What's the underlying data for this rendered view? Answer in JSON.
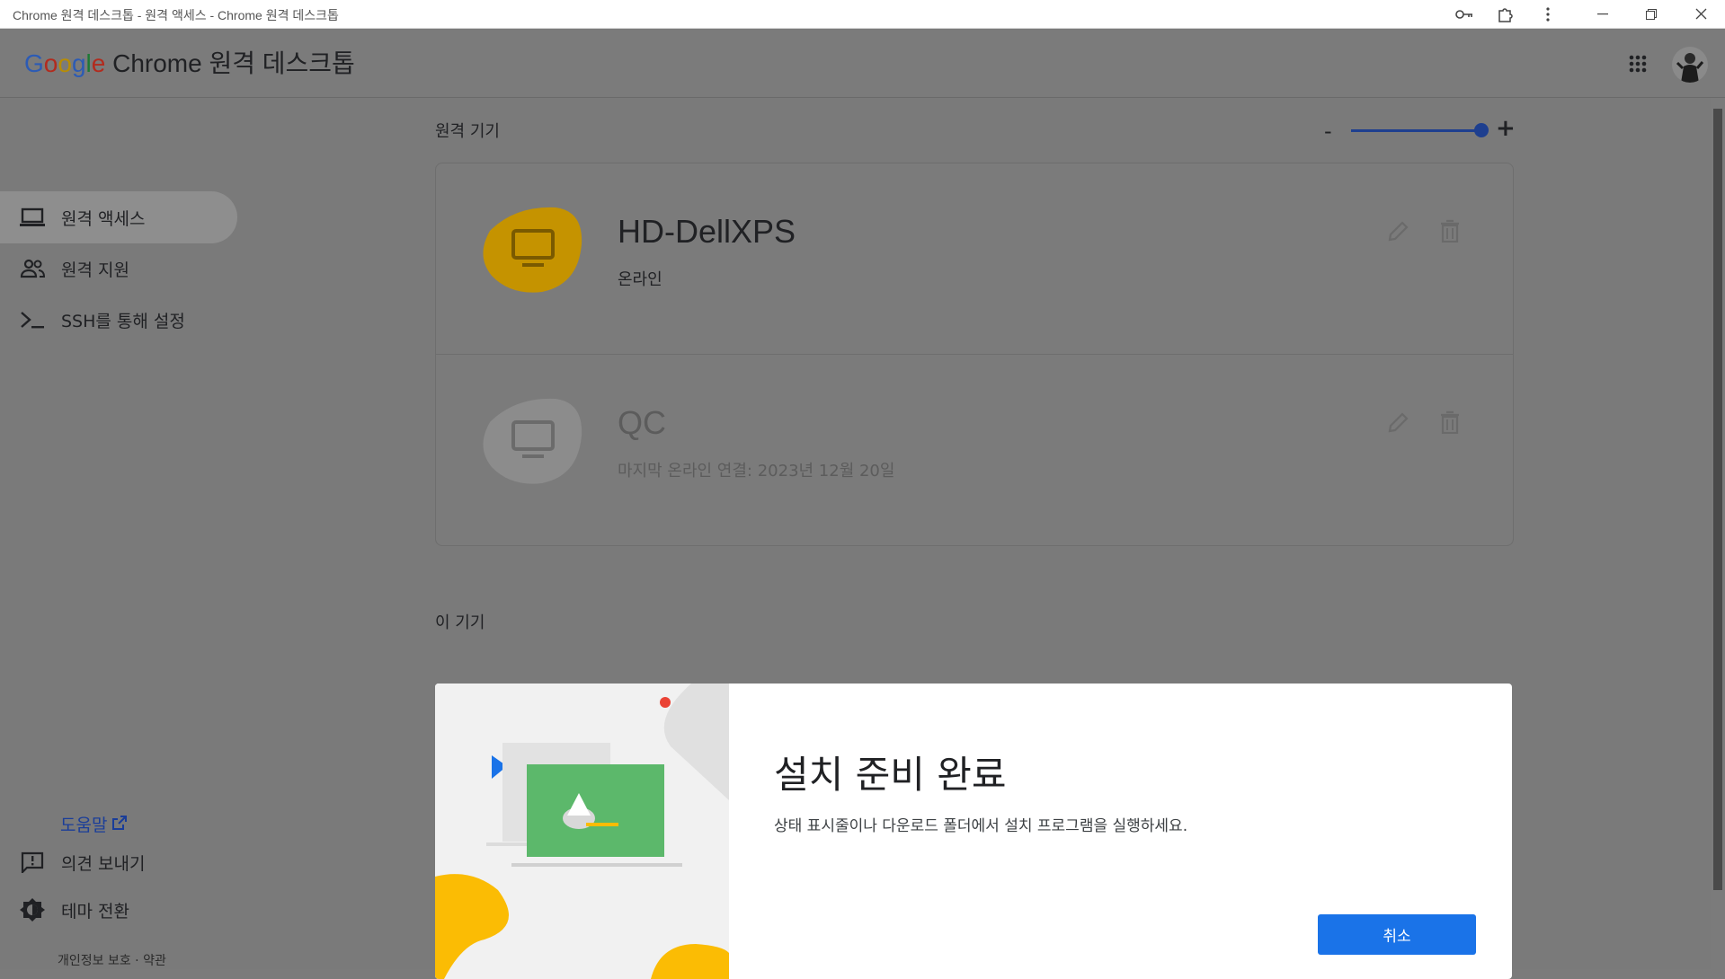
{
  "window": {
    "title": "Chrome 원격 데스크톱 - 원격 액세스 - Chrome 원격 데스크톱",
    "controls": [
      "key-icon",
      "extension-icon",
      "more-vert-icon",
      "minimize-icon",
      "restore-icon",
      "close-icon"
    ]
  },
  "header": {
    "brand_google": [
      "G",
      "o",
      "o",
      "g",
      "l",
      "e"
    ],
    "brand_product": "Chrome 원격 데스크톱"
  },
  "sidebar": {
    "items": [
      {
        "label": "원격 액세스",
        "icon": "laptop-icon",
        "active": true
      },
      {
        "label": "원격 지원",
        "icon": "people-icon",
        "active": false
      },
      {
        "label": "SSH를 통해 설정",
        "icon": "terminal-icon",
        "active": false
      }
    ],
    "help": "도움말",
    "feedback": "의견 보내기",
    "theme": "테마 전환",
    "legal": "개인정보 보호 · 약관"
  },
  "remote_devices": {
    "section_title": "원격 기기",
    "zoom_minus": "-",
    "zoom_plus": "+",
    "zoom_level": 1.0,
    "devices": [
      {
        "name": "HD-DellXPS",
        "status": "온라인",
        "online": true,
        "color": "#c59300"
      },
      {
        "name": "QC",
        "status": "마지막 온라인 연결: 2023년 12월 20일",
        "online": false,
        "color": "#8c8c8c"
      }
    ]
  },
  "this_device": {
    "section_title": "이 기기"
  },
  "dialog": {
    "title": "설치 준비 완료",
    "message": "상태 표시줄이나 다운로드 폴더에서 설치 프로그램을 실행하세요.",
    "cancel_label": "취소",
    "accent": "#1a73e8"
  }
}
